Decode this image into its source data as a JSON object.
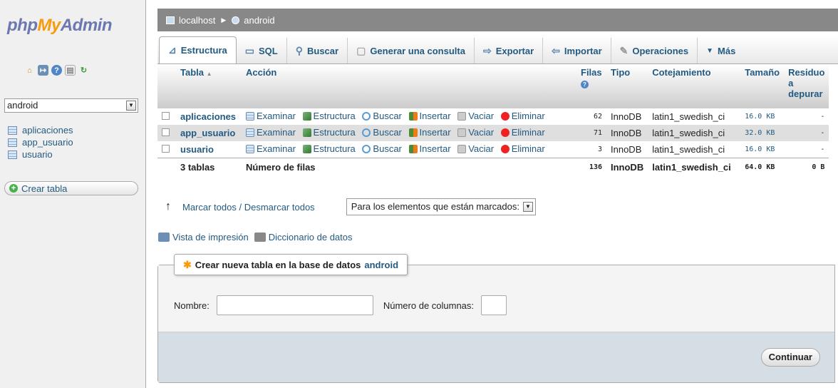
{
  "nav": {
    "logo_part1": "php",
    "logo_part2": "My",
    "logo_part3": "Admin",
    "database_select": "android",
    "tables": [
      "aplicaciones",
      "app_usuario",
      "usuario"
    ],
    "create_table": "Crear tabla"
  },
  "breadcrumb": {
    "server": "localhost",
    "database": "android"
  },
  "tabs": [
    {
      "label": "Estructura",
      "icon": "structure-icon"
    },
    {
      "label": "SQL",
      "icon": "sql-icon"
    },
    {
      "label": "Buscar",
      "icon": "search-icon"
    },
    {
      "label": "Generar una consulta",
      "icon": "query-icon"
    },
    {
      "label": "Exportar",
      "icon": "export-icon"
    },
    {
      "label": "Importar",
      "icon": "import-icon"
    },
    {
      "label": "Operaciones",
      "icon": "wrench-icon"
    },
    {
      "label": "Más",
      "icon": "chevron-down-icon"
    }
  ],
  "table": {
    "headers": {
      "tabla": "Tabla",
      "accion": "Acción",
      "filas": "Filas",
      "tipo": "Tipo",
      "cotejamiento": "Cotejamiento",
      "tamano": "Tamaño",
      "residuo": "Residuo a depurar"
    },
    "actions": [
      "Examinar",
      "Estructura",
      "Buscar",
      "Insertar",
      "Vaciar",
      "Eliminar"
    ],
    "rows": [
      {
        "name": "aplicaciones",
        "rows": "62",
        "type": "InnoDB",
        "collation": "latin1_swedish_ci",
        "size": "16.0 KB",
        "overhead": "-"
      },
      {
        "name": "app_usuario",
        "rows": "71",
        "type": "InnoDB",
        "collation": "latin1_swedish_ci",
        "size": "32.0 KB",
        "overhead": "-"
      },
      {
        "name": "usuario",
        "rows": "3",
        "type": "InnoDB",
        "collation": "latin1_swedish_ci",
        "size": "16.0 KB",
        "overhead": "-"
      }
    ],
    "footer": {
      "count": "3 tablas",
      "label": "Número de filas",
      "rows": "136",
      "type": "InnoDB",
      "collation": "latin1_swedish_ci",
      "size": "64.0 KB",
      "overhead": "0 B"
    }
  },
  "check_all": "Marcar todos / Desmarcar todos",
  "with_selected": "Para los elementos que están marcados:",
  "print_view": "Vista de impresión",
  "data_dictionary": "Diccionario de datos",
  "create": {
    "legend": "Crear nueva tabla en la base de datos",
    "db": "android",
    "name_label": "Nombre:",
    "columns_label": "Número de columnas:",
    "submit": "Continuar"
  }
}
